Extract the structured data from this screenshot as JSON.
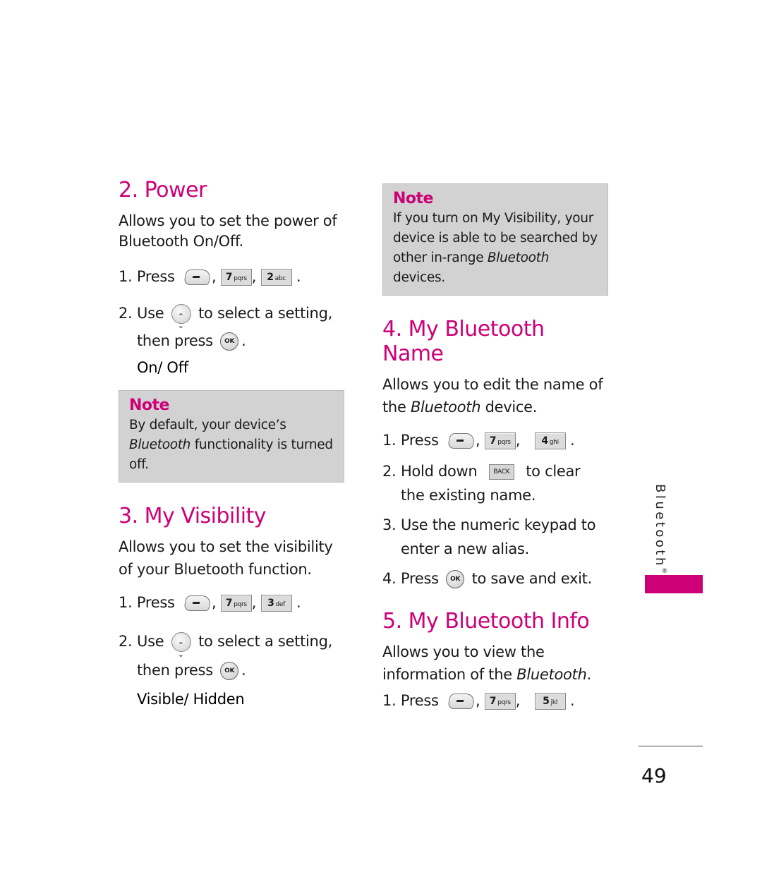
{
  "colors": {
    "accent": "#cc0077",
    "note_bg": "#d2d2d2"
  },
  "left": {
    "power": {
      "title": "2. Power",
      "desc": "Allows you to set the power of Bluetooth On/Off.",
      "steps": [
        {
          "num": "1.",
          "text_before": "Press",
          "keys": [
            "left-softkey",
            "7 pqrs",
            "2 abc"
          ]
        },
        {
          "num": "2.",
          "text_use": "Use",
          "text_after_nav": "to select a setting,",
          "text_then": "then press",
          "period": "."
        }
      ],
      "options": "On/ Off"
    },
    "note": {
      "title": "Note",
      "body_pre": "By default, your device’s",
      "body_italic": "Bluetooth",
      "body_post": " functionality is turned off."
    },
    "visibility": {
      "title": "3. My Visibility",
      "desc": "Allows you to set the visibility of your Bluetooth function.",
      "steps": [
        {
          "num": "1.",
          "text_before": "Press",
          "keys": [
            "left-softkey",
            "7 pqrs",
            "3 def"
          ]
        },
        {
          "num": "2.",
          "text_use": "Use",
          "text_after_nav": "to select a setting,",
          "text_then": "then press",
          "period": "."
        }
      ],
      "options": "Visible/ Hidden"
    }
  },
  "right": {
    "note": {
      "title": "Note",
      "body_pre": "If you turn on My Visibility, your device is able to be searched by other in-range ",
      "body_italic": "Bluetooth",
      "body_post": " devices."
    },
    "name": {
      "title": "4. My Bluetooth Name",
      "desc_pre": "Allows you to edit the name of the ",
      "desc_italic": "Bluetooth",
      "desc_post": " device.",
      "steps": [
        {
          "num": "1.",
          "text": "Press",
          "keys": [
            "left-softkey",
            "7 pqrs",
            "4 ghi"
          ]
        },
        {
          "num": "2.",
          "text_before": "Hold down",
          "key": "BACK",
          "text_after": "to clear the existing name."
        },
        {
          "num": "3.",
          "text": "Use the numeric keypad to enter a new alias."
        },
        {
          "num": "4.",
          "text_before": "Press",
          "key": "OK",
          "text_after": "to save and exit."
        }
      ]
    },
    "info": {
      "title": "5. My Bluetooth Info",
      "desc_pre": "Allows you to view the information of the ",
      "desc_italic": "Bluetooth",
      "desc_post": ".",
      "steps": [
        {
          "num": "1.",
          "text": "Press",
          "keys": [
            "left-softkey",
            "7 pqrs",
            "5 jkl"
          ]
        }
      ]
    }
  },
  "keys": {
    "k7_num": "7",
    "k7_letters": "pqrs",
    "k2_num": "2",
    "k2_letters": "abc",
    "k3_num": "3",
    "k3_letters": "def",
    "k4_num": "4",
    "k4_letters": "ghi",
    "k5_num": "5",
    "k5_letters": "jkl",
    "ok": "OK",
    "back": "BACK",
    "comma": ",",
    "period": "."
  },
  "sidebar": {
    "section_label": "Bluetooth",
    "reg_mark": "®"
  },
  "footer": {
    "page_number": "49"
  }
}
